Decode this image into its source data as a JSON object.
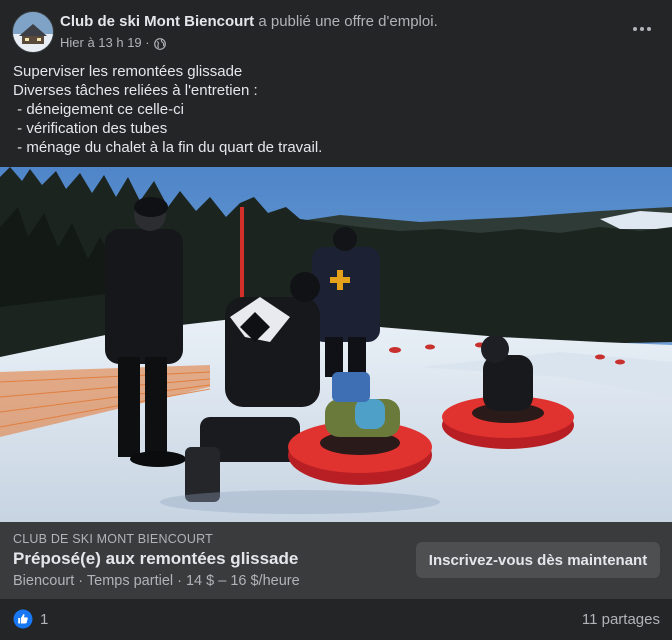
{
  "post": {
    "page_name": "Club de ski Mont Biencourt",
    "action": " a publié une offre d'emploi.",
    "timestamp": "Hier à 13 h 19 ·",
    "privacy_icon": "globe-icon",
    "more_icon": "more-options-icon"
  },
  "body": {
    "lines": [
      "Superviser les remontées glissade",
      "Diverses tâches reliées à l'entretien :",
      " - déneigement ce celle-ci",
      " - vérification des tubes",
      " - ménage du chalet à la fin du quart de travail."
    ]
  },
  "job": {
    "org": "CLUB DE SKI MONT BIENCOURT",
    "title": "Préposé(e) aux remontées glissade",
    "meta": "Biencourt · Temps partiel · 14 $ – 16 $/heure",
    "apply_label": "Inscrivez-vous dès maintenant"
  },
  "footer": {
    "like_count": "1",
    "shares": "11 partages",
    "like_icon": "like-reaction-icon"
  },
  "colors": {
    "background": "#242526",
    "card": "#3a3b3c",
    "button": "#4e4f50",
    "text_primary": "#e4e6eb",
    "text_secondary": "#b0b3b8",
    "like_blue": "#1877f2"
  }
}
